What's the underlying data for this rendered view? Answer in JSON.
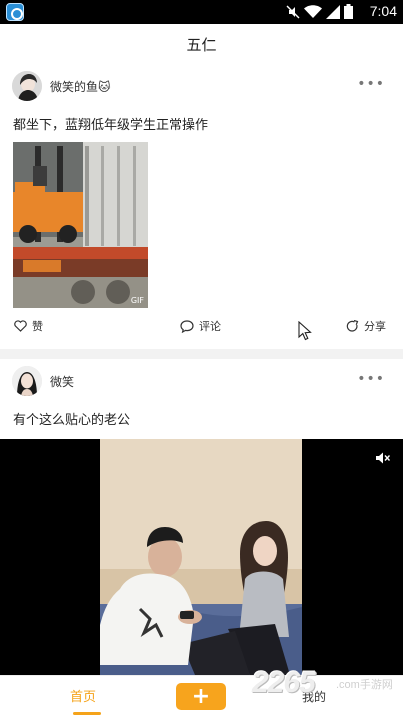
{
  "status_bar": {
    "time": "7:04",
    "icons": [
      "app-icon",
      "mute-icon",
      "wifi-icon",
      "signal-icon",
      "battery-icon"
    ]
  },
  "header": {
    "title": "五仁"
  },
  "feed": {
    "posts": [
      {
        "author": "微笑的鱼🐱",
        "text": "都坐下，蓝翔低年级学生正常操作",
        "media_type": "gif",
        "media_badge": "GIF",
        "actions": {
          "like": "赞",
          "comment": "评论",
          "share": "分享"
        },
        "more_icon": "more-icon"
      },
      {
        "author": "微笑",
        "text": "有个这么贴心的老公",
        "media_type": "video",
        "more_icon": "more-icon"
      }
    ]
  },
  "tab_bar": {
    "home": "首页",
    "add": "+",
    "mine": "我的"
  },
  "watermark": {
    "main": "2265",
    "sub": ".com手游网"
  },
  "colors": {
    "accent": "#f7a41d",
    "status_bar": "#000000",
    "divider": "#f2f2f2"
  }
}
